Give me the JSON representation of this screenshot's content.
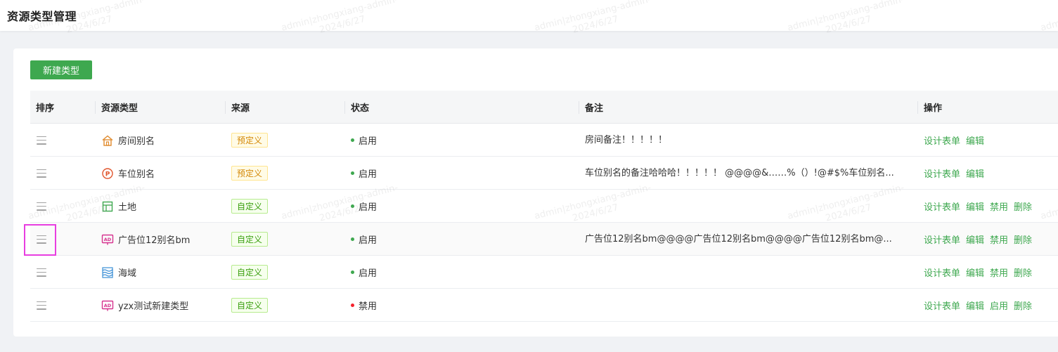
{
  "page": {
    "title": "资源类型管理"
  },
  "toolbar": {
    "new_type_label": "新建类型"
  },
  "table": {
    "columns": {
      "sort": "排序",
      "type": "资源类型",
      "source": "来源",
      "status": "状态",
      "remark": "备注",
      "actions": "操作"
    },
    "rows": [
      {
        "name": "房间别名",
        "icon": "house-icon",
        "source": "预定义",
        "source_kind": "predef",
        "status": "启用",
        "status_color": "#3ea84f",
        "remark": "房间备注！！！！！",
        "actions": [
          "设计表单",
          "编辑"
        ]
      },
      {
        "name": "车位别名",
        "icon": "parking-icon",
        "source": "预定义",
        "source_kind": "predef",
        "status": "启用",
        "status_color": "#3ea84f",
        "remark": "车位别名的备注哈哈哈！！！！！ @@@@&……%（）!@#$%车位别名...",
        "actions": [
          "设计表单",
          "编辑"
        ]
      },
      {
        "name": "土地",
        "icon": "land-icon",
        "source": "自定义",
        "source_kind": "custom",
        "status": "启用",
        "status_color": "#3ea84f",
        "remark": "",
        "actions": [
          "设计表单",
          "编辑",
          "禁用",
          "删除"
        ]
      },
      {
        "name": "广告位12别名bm",
        "icon": "ad-icon",
        "source": "自定义",
        "source_kind": "custom",
        "status": "启用",
        "status_color": "#3ea84f",
        "remark": "广告位12别名bm@@@@广告位12别名bm@@@@广告位12别名bm@...",
        "actions": [
          "设计表单",
          "编辑",
          "禁用",
          "删除"
        ]
      },
      {
        "name": "海域",
        "icon": "sea-icon",
        "source": "自定义",
        "source_kind": "custom",
        "status": "启用",
        "status_color": "#3ea84f",
        "remark": "",
        "actions": [
          "设计表单",
          "编辑",
          "禁用",
          "删除"
        ]
      },
      {
        "name": "yzx测试新建类型",
        "icon": "ad-icon",
        "source": "自定义",
        "source_kind": "custom",
        "status": "禁用",
        "status_color": "#f5222d",
        "remark": "",
        "actions": [
          "设计表单",
          "编辑",
          "启用",
          "删除"
        ]
      }
    ]
  },
  "watermark": {
    "line1": "admin|zhongxiang-admin-",
    "line2": "2024/6/27"
  },
  "colors": {
    "accent": "#3ea84f",
    "enabled": "#3ea84f",
    "disabled": "#f5222d",
    "predef_tag": "#d48806",
    "custom_tag": "#389e0d",
    "focus_outline": "#e83ee0"
  }
}
